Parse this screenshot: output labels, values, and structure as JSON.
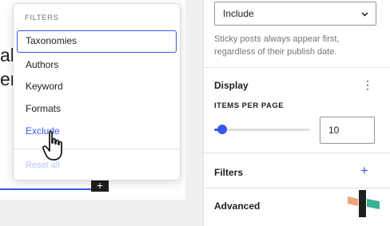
{
  "canvas": {
    "bg_lines": [
      "al-",
      "er"
    ],
    "inserter_glyph": "+"
  },
  "dropdown": {
    "title": "FILTERS",
    "items": [
      {
        "label": "Taxonomies",
        "state": "focused"
      },
      {
        "label": "Authors",
        "state": "normal"
      },
      {
        "label": "Keyword",
        "state": "normal"
      },
      {
        "label": "Formats",
        "state": "normal"
      },
      {
        "label": "Exclude",
        "state": "hovered"
      }
    ],
    "reset_label": "Reset all"
  },
  "sidebar": {
    "sticky_select": {
      "value": "Include"
    },
    "sticky_help": "Sticky posts always appear first, regardless of their publish date.",
    "display_panel": {
      "title": "Display",
      "menu_glyph": "⋮",
      "items_per_page_label": "ITEMS PER PAGE",
      "items_per_page_value": "10",
      "slider_fraction": 0.08
    },
    "filters_panel": {
      "title": "Filters",
      "add_glyph": "+"
    },
    "advanced_panel": {
      "title": "Advanced"
    }
  },
  "colors": {
    "accent": "#3858e9",
    "text": "#1e1e1e",
    "muted": "#757575",
    "border": "#e0e0e0",
    "logo_dark": "#1e1e1e",
    "logo_orange": "#f0a47a",
    "logo_green": "#3cb095"
  },
  "icons": {
    "cursor": "hand-pointer-icon",
    "select_chevron": "chevron-down-icon",
    "kebab": "more-vertical-icon",
    "add": "plus-icon"
  }
}
